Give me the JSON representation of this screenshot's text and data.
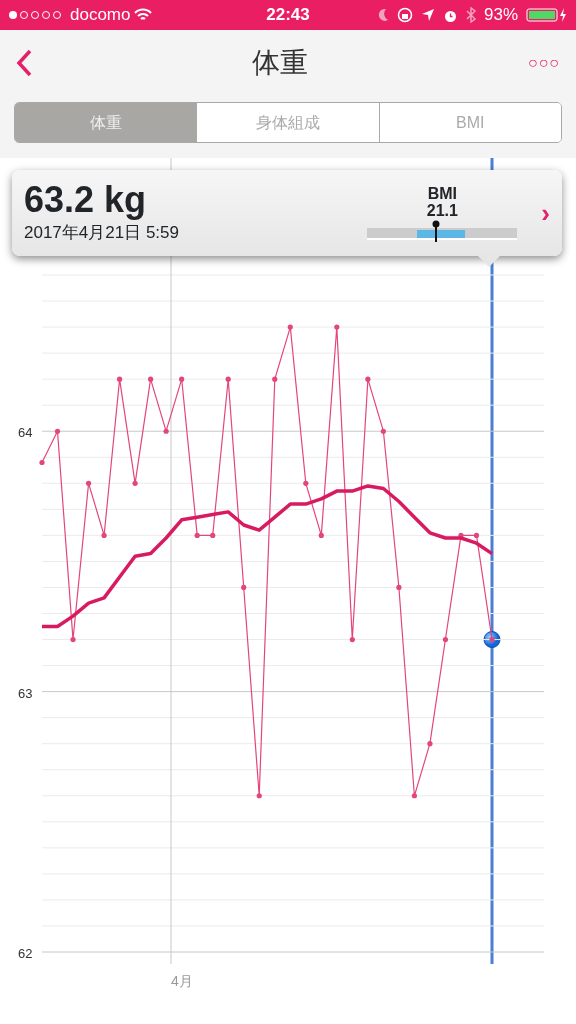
{
  "status_bar": {
    "carrier": "docomo",
    "time": "22:43",
    "battery": "93%"
  },
  "nav": {
    "title": "体重",
    "more": "○○○"
  },
  "tabs": [
    {
      "label": "体重",
      "selected": true
    },
    {
      "label": "身体組成",
      "selected": false
    },
    {
      "label": "BMI",
      "selected": false
    }
  ],
  "popup": {
    "weight": "63.2 kg",
    "date": "2017年4月21日 5:59",
    "bmi_label": "BMI",
    "bmi_value": "21.1",
    "bmi_gauge": {
      "level": 0.46
    },
    "arrow": "›"
  },
  "cursor": {
    "on_last_point": true
  },
  "month_label": "4月",
  "chart_data": {
    "type": "line",
    "grid": true,
    "ylim": [
      62,
      64.6
    ],
    "yticks": [
      {
        "value": 62,
        "label": "62"
      },
      {
        "value": 63,
        "label": "63"
      },
      {
        "value": 64,
        "label": "64"
      }
    ],
    "series": [
      {
        "color": "#e3457e",
        "values": [
          63.88,
          64.0,
          63.2,
          63.8,
          63.6,
          64.2,
          63.8,
          64.2,
          64.0,
          64.2,
          63.6,
          63.6,
          64.2,
          63.4,
          62.6,
          64.2,
          64.4,
          63.8,
          63.6,
          64.4,
          63.2,
          64.2,
          64.0,
          63.4,
          62.6,
          62.8,
          63.2,
          63.6,
          63.6,
          63.2
        ]
      },
      {
        "color": "#d81b60",
        "values": [
          63.25,
          63.25,
          63.29,
          63.34,
          63.36,
          63.44,
          63.52,
          63.53,
          63.59,
          63.66,
          63.67,
          63.68,
          63.69,
          63.64,
          63.62,
          63.67,
          63.72,
          63.72,
          63.74,
          63.77,
          63.77,
          63.79,
          63.78,
          63.73,
          63.67,
          63.61,
          63.59,
          63.59,
          63.57,
          63.53
        ]
      }
    ]
  }
}
